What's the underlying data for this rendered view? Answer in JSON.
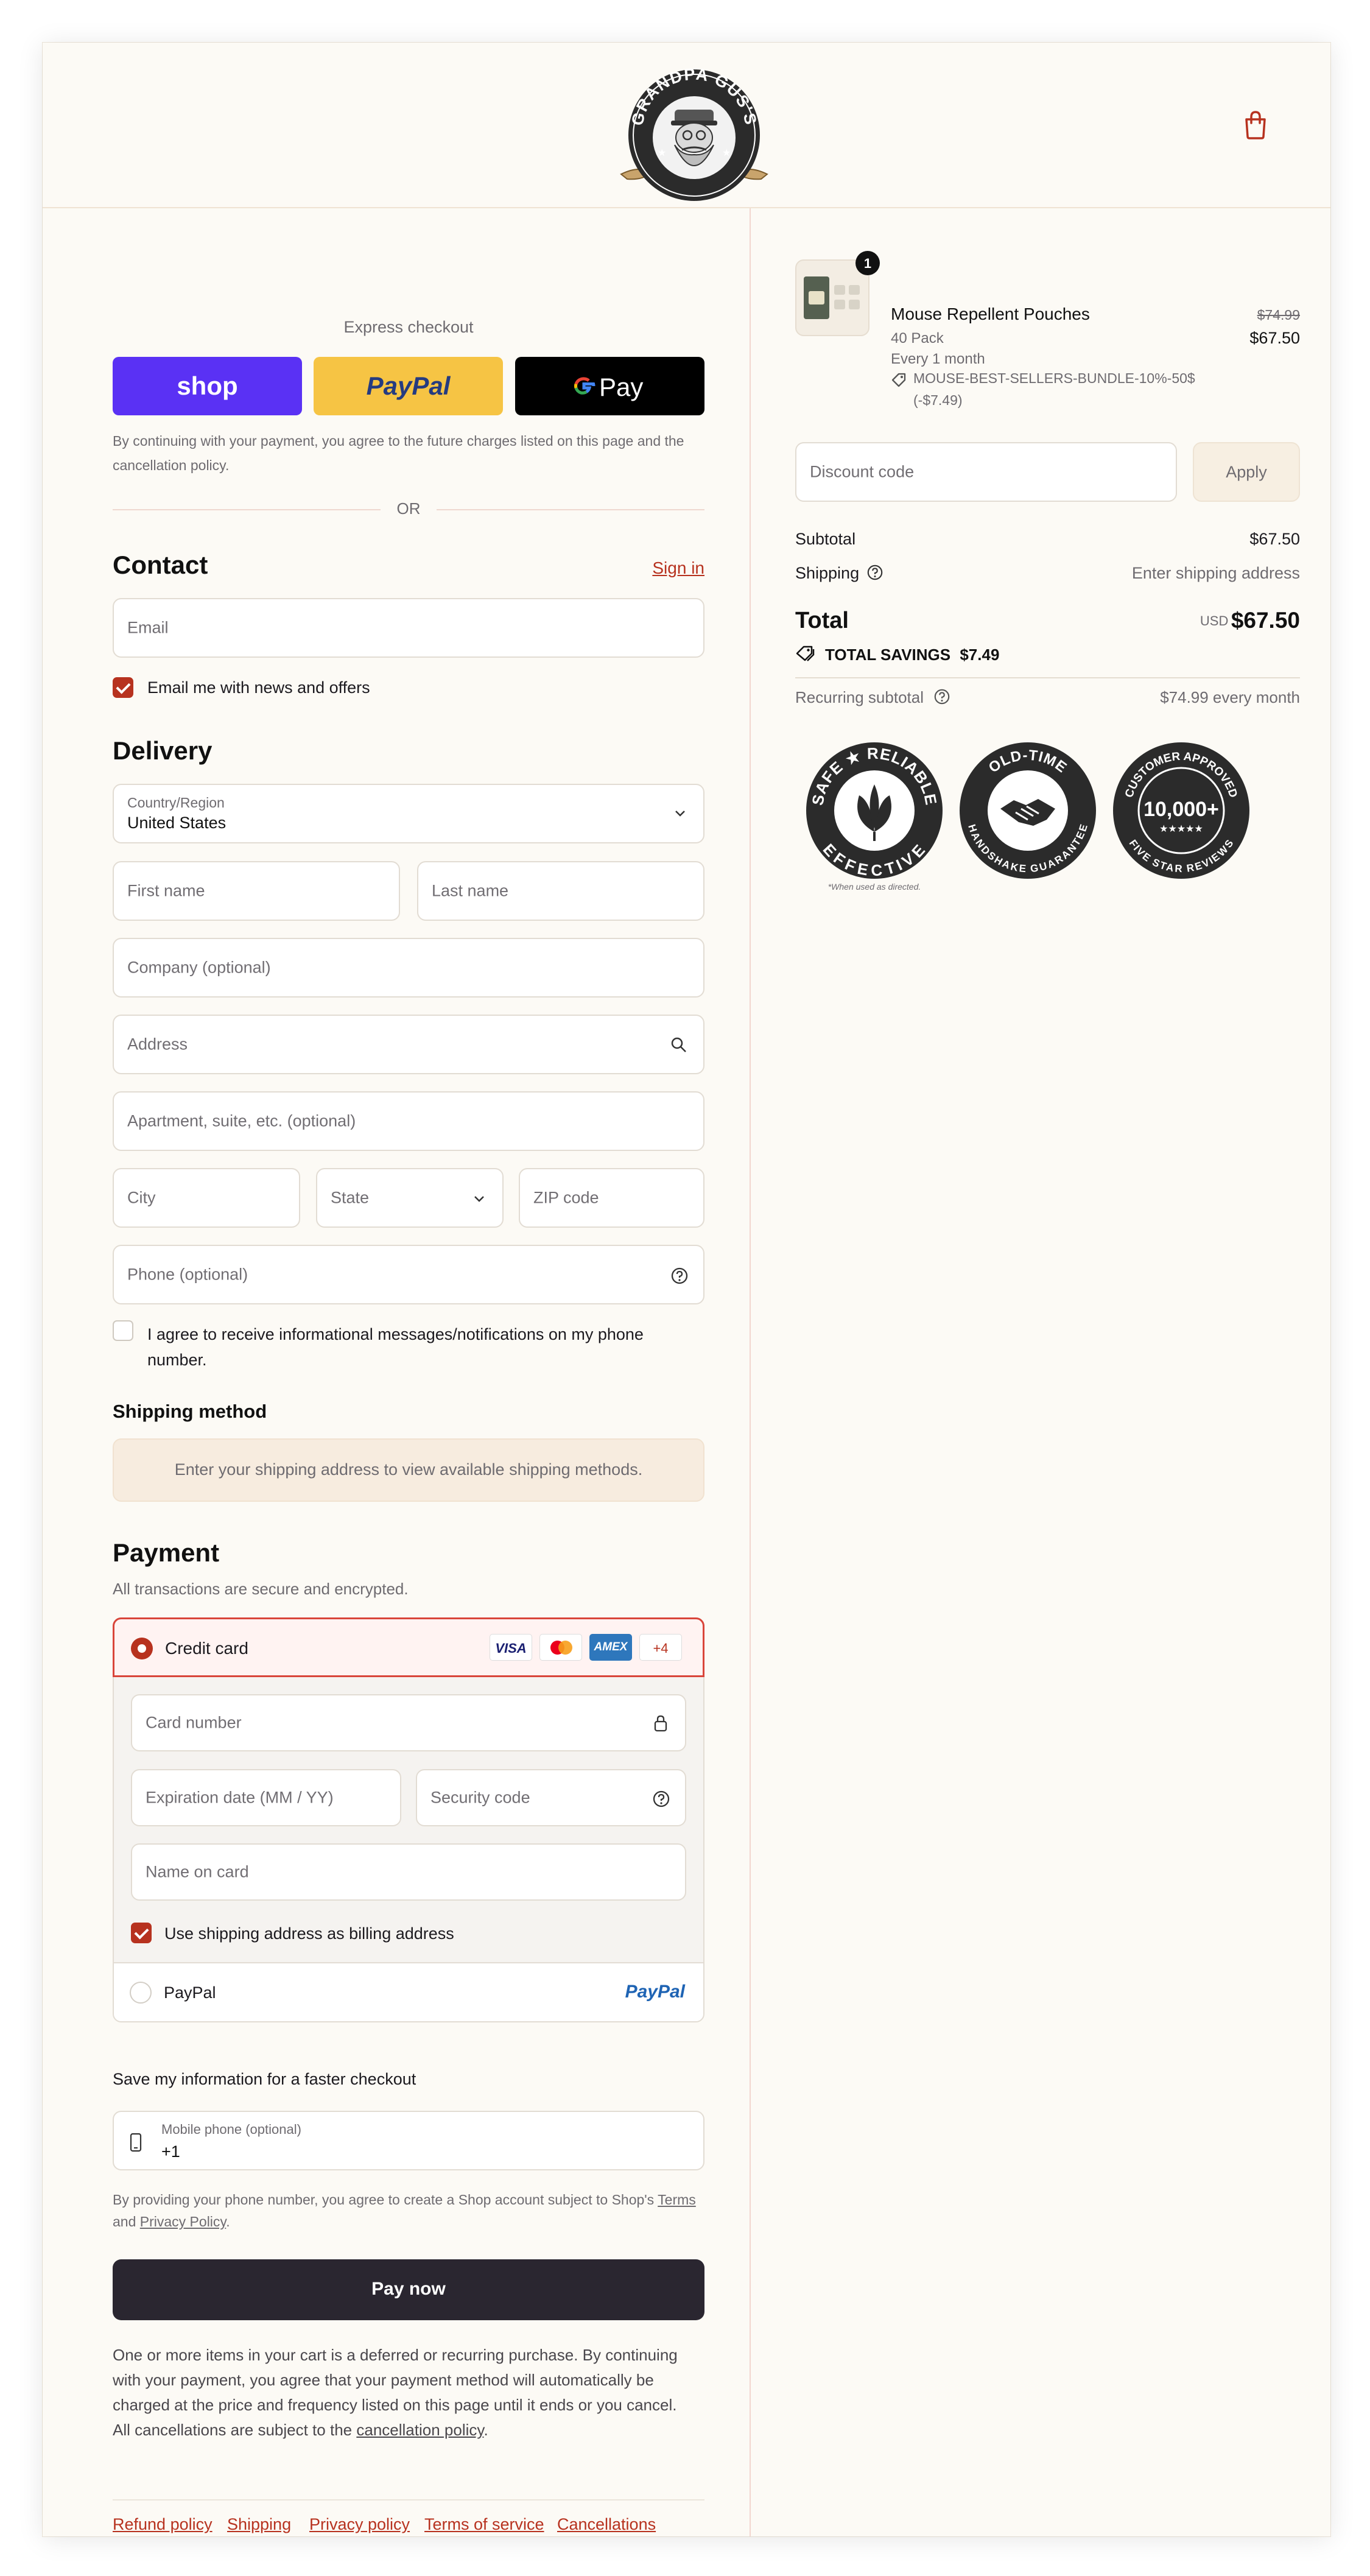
{
  "brand": {
    "logo_text": "GRANDPA GUS'S"
  },
  "express": {
    "title": "Express checkout",
    "shop_label": "shop",
    "paypal_label": "PayPal",
    "gpay_label": "Pay",
    "disclaimer": "By continuing with your payment, you agree to the future charges listed on this page and the cancellation policy.",
    "or_label": "OR"
  },
  "contact": {
    "title": "Contact",
    "sign_in": "Sign in",
    "email_placeholder": "Email",
    "news_label": "Email me with news and offers",
    "news_checked": true
  },
  "delivery": {
    "title": "Delivery",
    "country_label": "Country/Region",
    "country_value": "United States",
    "first_name": "First name",
    "last_name": "Last name",
    "company": "Company (optional)",
    "address": "Address",
    "apartment": "Apartment, suite, etc. (optional)",
    "city": "City",
    "state": "State",
    "zip": "ZIP code",
    "phone": "Phone (optional)",
    "sms_label": "I agree to receive informational messages/notifications on my phone number."
  },
  "shipping": {
    "title": "Shipping method",
    "notice": "Enter your shipping address to view available shipping methods."
  },
  "payment": {
    "title": "Payment",
    "subtitle": "All transactions are secure and encrypted.",
    "credit_card_label": "Credit card",
    "card_brands": [
      "VISA",
      "",
      "AMEX"
    ],
    "more_brands": "+4",
    "card_number": "Card number",
    "expiration": "Expiration date (MM / YY)",
    "security_code": "Security code",
    "name_on_card": "Name on card",
    "billing_same": "Use shipping address as billing address",
    "paypal_option": "PayPal",
    "paypal_logo": "PayPal"
  },
  "save_info": {
    "title": "Save my information for a faster checkout",
    "mobile_label": "Mobile phone (optional)",
    "mobile_value": "+1",
    "terms_prefix": "By providing your phone number, you agree to create a Shop account subject to Shop's",
    "terms_link": "Terms",
    "and_text": "and",
    "privacy_link": "Privacy Policy",
    "period": "."
  },
  "pay_now": "Pay now",
  "recurring_notice": {
    "line1": "One or more items in your cart is a deferred or recurring purchase. By continuing",
    "line2": "with your payment, you agree that your payment method will automatically be",
    "line3": "charged at the price and frequency listed on this page until it ends or you cancel.",
    "line4_prefix": "All cancellations are subject to the",
    "line4_link": "cancellation policy",
    "line4_suffix": "."
  },
  "footer": {
    "links": [
      "Refund policy",
      "Shipping",
      "Privacy policy",
      "Terms of service",
      "Cancellations"
    ]
  },
  "summary": {
    "product_name": "Mouse Repellent Pouches",
    "quantity_badge": "1",
    "variant": "40 Pack",
    "frequency": "Every 1 month",
    "discount_code_applied": "MOUSE-BEST-SELLERS-BUNDLE-10%-50$",
    "discount_amount": "(-$7.49)",
    "original_price": "$74.99",
    "price": "$67.50",
    "discount_placeholder": "Discount code",
    "apply_label": "Apply",
    "subtotal_label": "Subtotal",
    "subtotal_value": "$67.50",
    "shipping_label": "Shipping",
    "shipping_value": "Enter shipping address",
    "total_label": "Total",
    "currency": "USD",
    "total_value": "$67.50",
    "savings_label": "TOTAL SAVINGS",
    "savings_value": "$7.49",
    "recurring_label": "Recurring subtotal",
    "recurring_value": "$74.99 every month"
  },
  "badges": {
    "badge1_top": "SAFE ★ RELIABLE",
    "badge1_bottom": "EFFECTIVE",
    "badge1_note": "*When used as directed.",
    "badge2_top": "OLD-TIME",
    "badge2_bottom": "HANDSHAKE GUARANTEE",
    "badge3_top": "CUSTOMER APPROVED",
    "badge3_center": "10,000+",
    "badge3_bottom": "FIVE STAR REVIEWS"
  },
  "colors": {
    "accent": "#b7321f",
    "shop_purple": "#5a31f4",
    "paypal_yellow": "#f6c444",
    "pay_button": "#2a2630",
    "background": "#fcfaf5"
  }
}
